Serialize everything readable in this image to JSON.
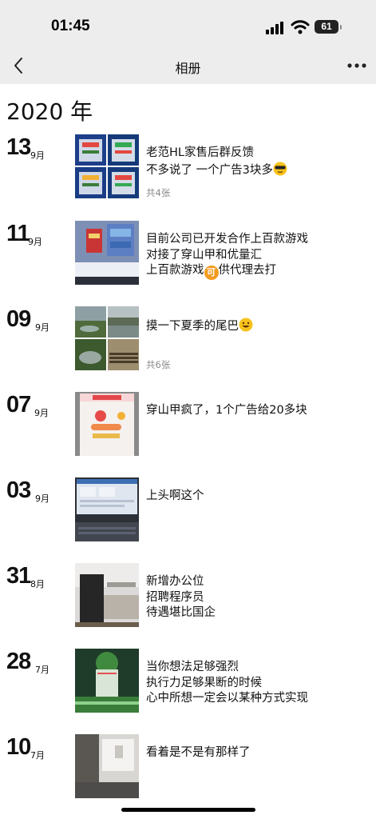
{
  "status": {
    "time": "01:45",
    "battery": "61"
  },
  "nav": {
    "title": "相册"
  },
  "year": "2020 年",
  "posts": [
    {
      "day": "13",
      "month": "9月",
      "caption": "老范HL家售后群反馈\n不多说了 一个广告3块多",
      "emoji": "sunglasses-emoji",
      "count": "共4张"
    },
    {
      "day": "11",
      "month": "9月",
      "caption": "目前公司已开发合作上百款游戏\n对接了穿山甲和优量汇\n上百款游戏",
      "emoji": "ke-badge-emoji",
      "emoji_label": "可",
      "caption_tail": "供代理去打",
      "count": ""
    },
    {
      "day": "09",
      "month": "9月",
      "caption": "摸一下夏季的尾巴",
      "emoji": "grin-emoji",
      "count": "共6张"
    },
    {
      "day": "07",
      "month": "9月",
      "caption": "穿山甲疯了，1个广告给20多块",
      "count": ""
    },
    {
      "day": "03",
      "month": "9月",
      "caption": "上头啊这个",
      "count": ""
    },
    {
      "day": "31",
      "month": "8月",
      "caption": "新增办公位\n招聘程序员\n待遇堪比国企",
      "count": ""
    },
    {
      "day": "28",
      "month": "7月",
      "caption": "当你想法足够强烈\n执行力足够果断的时候\n心中所想一定会以某种方式实现",
      "count": ""
    },
    {
      "day": "10",
      "month": "7月",
      "caption": "看着是不是有那样了",
      "count": ""
    }
  ],
  "colors": {
    "bar_bg": "#ededed",
    "emoji_yellow": "#f7c21c",
    "badge_orange": "#f39b1f",
    "muted": "#8a8a8a"
  }
}
